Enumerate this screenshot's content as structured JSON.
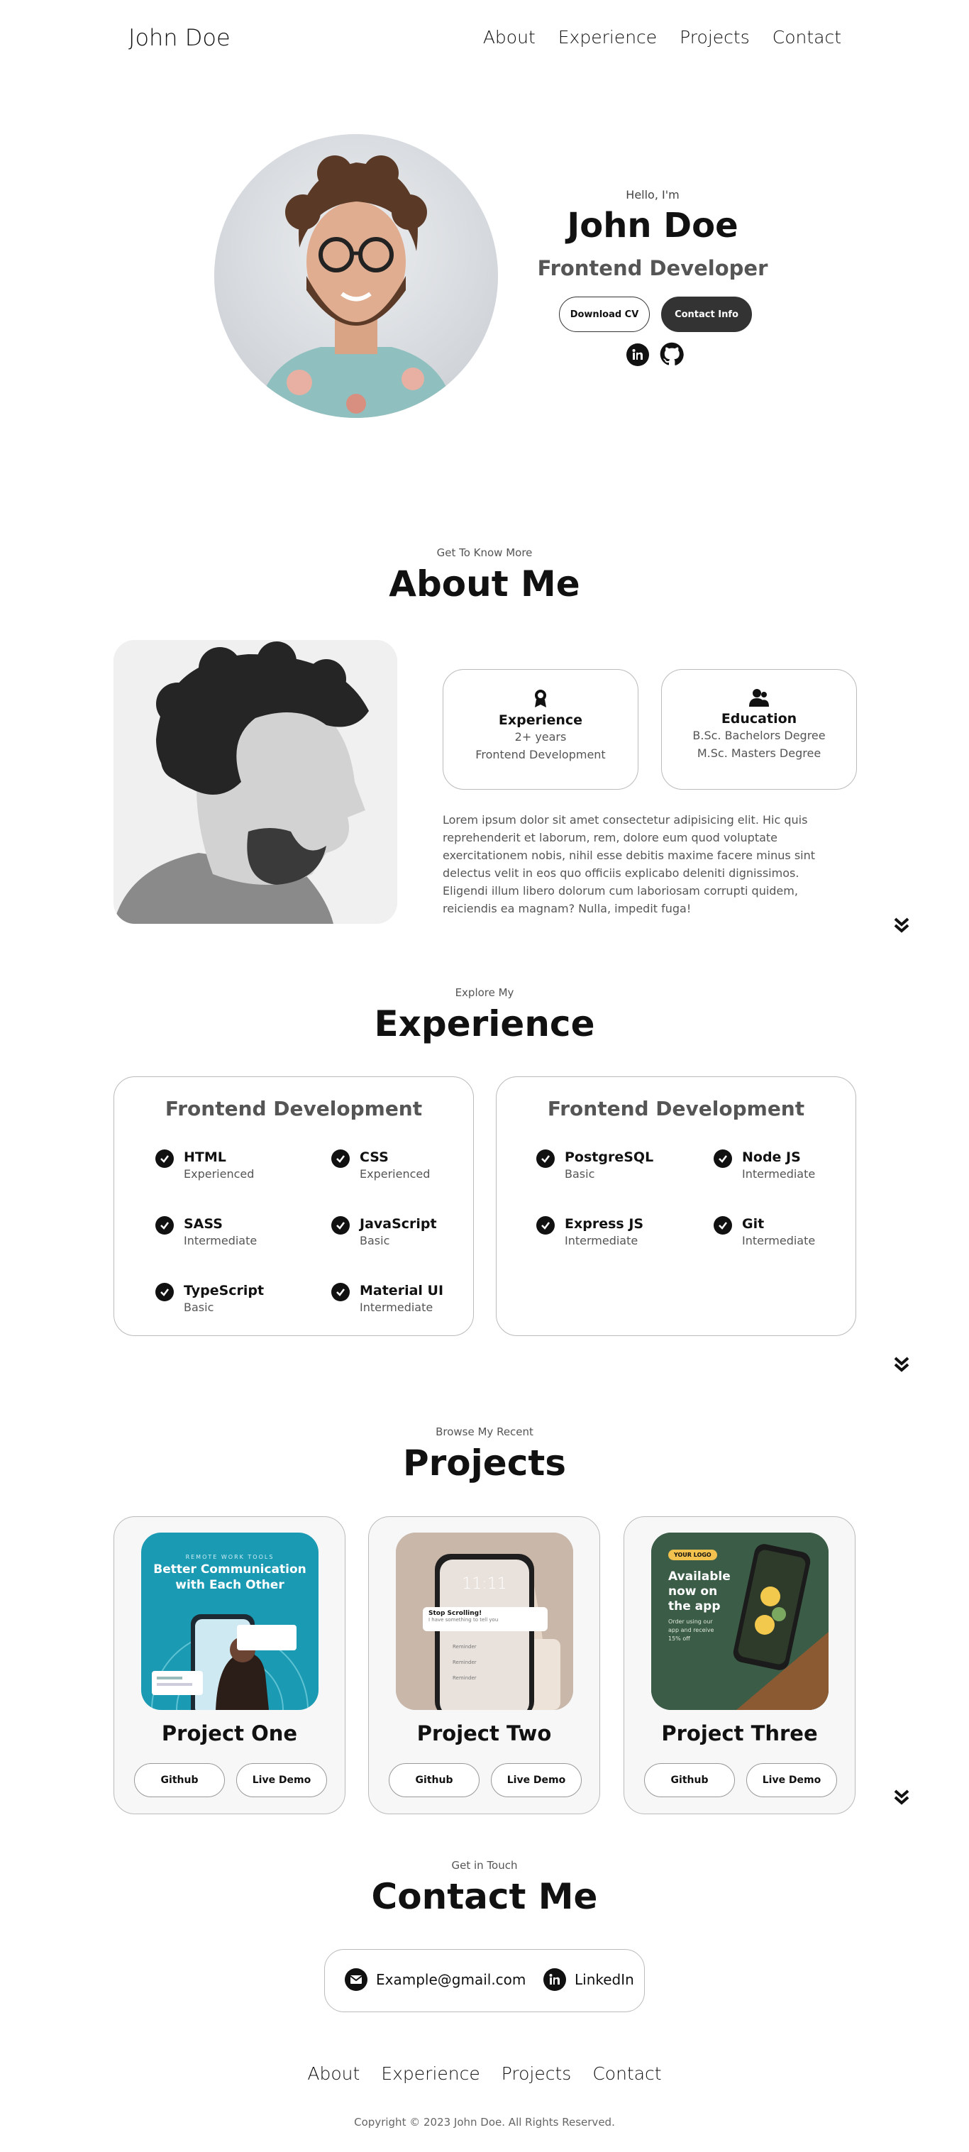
{
  "nav": {
    "logo": "John Doe",
    "links": [
      "About",
      "Experience",
      "Projects",
      "Contact"
    ]
  },
  "hero": {
    "greeting": "Hello, I'm",
    "name": "John Doe",
    "role": "Frontend Developer",
    "download_cv": "Download CV",
    "contact_info": "Contact Info"
  },
  "about": {
    "subtitle": "Get To Know More",
    "title": "About Me",
    "experience": {
      "title": "Experience",
      "line1": "2+ years",
      "line2": "Frontend Development"
    },
    "education": {
      "title": "Education",
      "line1": "B.Sc. Bachelors Degree",
      "line2": "M.Sc. Masters Degree"
    },
    "text": "Lorem ipsum dolor sit amet consectetur adipisicing elit. Hic quis reprehenderit et laborum, rem, dolore eum quod voluptate exercitationem nobis, nihil esse debitis maxime facere minus sint delectus velit in eos quo officiis explicabo deleniti dignissimos. Eligendi illum libero dolorum cum laboriosam corrupti quidem, reiciendis ea magnam? Nulla, impedit fuga!"
  },
  "experience": {
    "subtitle": "Explore My",
    "title": "Experience",
    "cards": [
      {
        "title": "Frontend Development",
        "skills": [
          {
            "name": "HTML",
            "level": "Experienced"
          },
          {
            "name": "CSS",
            "level": "Experienced"
          },
          {
            "name": "SASS",
            "level": "Intermediate"
          },
          {
            "name": "JavaScript",
            "level": "Basic"
          },
          {
            "name": "TypeScript",
            "level": "Basic"
          },
          {
            "name": "Material UI",
            "level": "Intermediate"
          }
        ]
      },
      {
        "title": "Frontend Development",
        "skills": [
          {
            "name": "PostgreSQL",
            "level": "Basic"
          },
          {
            "name": "Node JS",
            "level": "Intermediate"
          },
          {
            "name": "Express JS",
            "level": "Intermediate"
          },
          {
            "name": "Git",
            "level": "Intermediate"
          }
        ]
      }
    ]
  },
  "projects": {
    "subtitle": "Browse My Recent",
    "title": "Projects",
    "items": [
      {
        "title": "Project One",
        "github": "Github",
        "demo": "Live Demo",
        "image": {
          "tag": "REMOTE WORK TOOLS",
          "headline1": "Better Communication",
          "headline2": "with Each Other"
        }
      },
      {
        "title": "Project Two",
        "github": "Github",
        "demo": "Live Demo",
        "image": {
          "time": "11:11",
          "notif1": "Stop Scrolling!",
          "notif2": "I have something to tell you",
          "r1": "Reminder",
          "r2": "Reminder",
          "r3": "Reminder"
        }
      },
      {
        "title": "Project Three",
        "github": "Github",
        "demo": "Live Demo",
        "image": {
          "logo": "YOUR LOGO",
          "h1": "Available",
          "h2": "now on",
          "h3": "the app",
          "p1": "Order using our",
          "p2": "app and receive",
          "p3": "15% off"
        }
      }
    ]
  },
  "contact": {
    "subtitle": "Get in Touch",
    "title": "Contact Me",
    "email": "Example@gmail.com",
    "linkedin": "LinkedIn"
  },
  "footer": {
    "links": [
      "About",
      "Experience",
      "Projects",
      "Contact"
    ],
    "copyright": "Copyright © 2023 John Doe. All Rights Reserved."
  }
}
